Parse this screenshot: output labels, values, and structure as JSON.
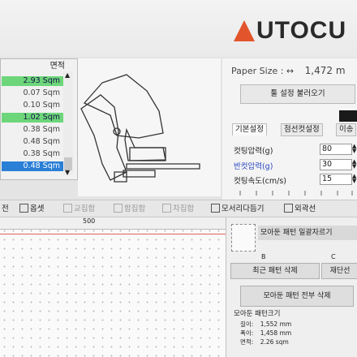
{
  "logo": {
    "text": "UTOCU",
    "accent_color": "#e2552c"
  },
  "area_list": {
    "header": "면적",
    "rows": [
      {
        "value": "2.93 Sqm",
        "state": "green"
      },
      {
        "value": "0.07 Sqm",
        "state": "normal"
      },
      {
        "value": "0.10 Sqm",
        "state": "normal"
      },
      {
        "value": "1.02 Sqm",
        "state": "green"
      },
      {
        "value": "0.38 Sqm",
        "state": "normal"
      },
      {
        "value": "0.48 Sqm",
        "state": "normal"
      },
      {
        "value": "0.38 Sqm",
        "state": "normal"
      },
      {
        "value": "0.48 Sqm",
        "state": "blue"
      }
    ]
  },
  "settings": {
    "paper_size_label": "Paper Size : ↔",
    "paper_size_value": "1,472 m",
    "load_button": "툴 설정 불러오기",
    "tabs": [
      "기본설정",
      "점선컷설정",
      "이송"
    ],
    "params": [
      {
        "label": "컷팅압력(g)",
        "value": "80"
      },
      {
        "label": "반컷압력(g)",
        "value": "30"
      },
      {
        "label": "컷팅속도(cm/s)",
        "value": "15"
      }
    ]
  },
  "toolbar": {
    "items": [
      {
        "label": "전",
        "enabled": true
      },
      {
        "label": "옵셋",
        "enabled": true
      },
      {
        "label": "교집합",
        "enabled": false
      },
      {
        "label": "합집합",
        "enabled": false
      },
      {
        "label": "차집합",
        "enabled": false
      },
      {
        "label": "모서리다듬기",
        "enabled": true
      },
      {
        "label": "외곽선",
        "enabled": true
      }
    ]
  },
  "canvas": {
    "ruler_label": "500"
  },
  "gather": {
    "title": "모아둔 패턴 일괄자르기",
    "col_b": "B",
    "col_c": "C",
    "btn_delete_latest": "최근 패턴 삭제",
    "btn_recall": "재단선",
    "btn_delete_all": "모아둔 패턴 전부 삭제",
    "size_title": "모아둔 패턴크기",
    "size_rows": [
      {
        "label": "길이:",
        "value": "1,552 mm"
      },
      {
        "label": "폭이:",
        "value": "1,458 mm"
      },
      {
        "label": "면적:",
        "value": "2.26 sqm"
      }
    ]
  }
}
